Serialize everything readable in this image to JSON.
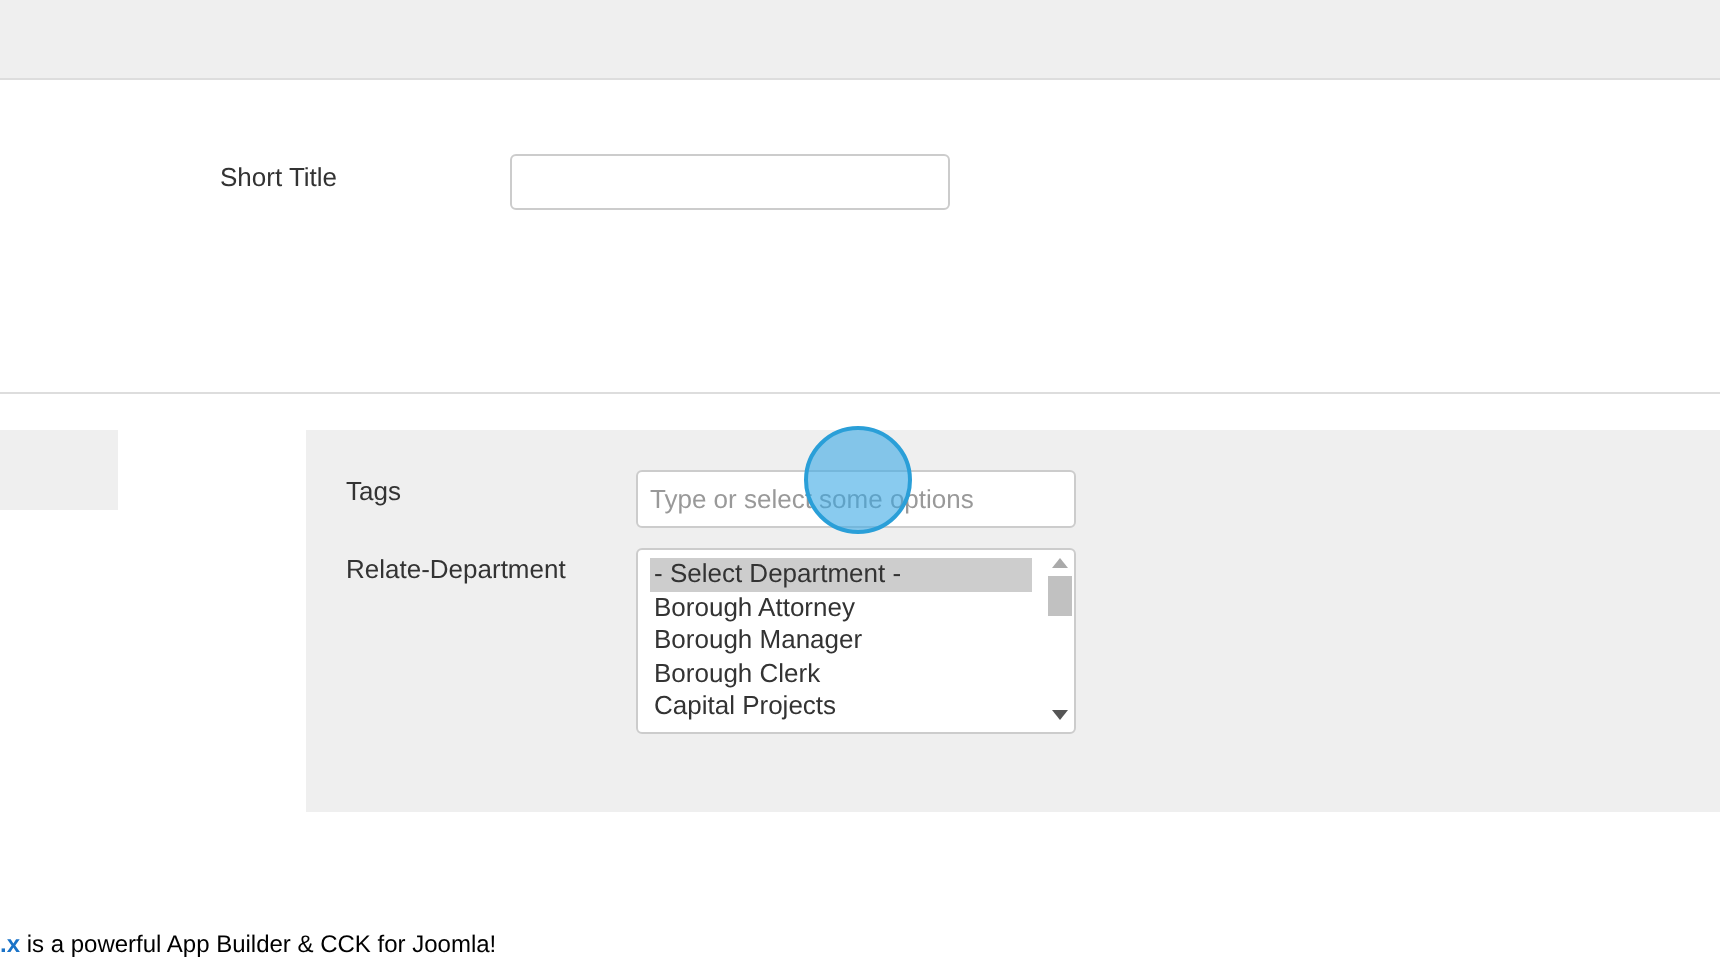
{
  "short_title": {
    "label": "Short Title"
  },
  "tags": {
    "label": "Tags",
    "placeholder": "Type or select some options"
  },
  "department": {
    "label": "Relate-Department",
    "options": [
      {
        "label": "- Select Department -",
        "selected": true
      },
      {
        "label": "Borough Attorney",
        "selected": false
      },
      {
        "label": "Borough Manager",
        "selected": false
      },
      {
        "label": "Borough Clerk",
        "selected": false
      },
      {
        "label": "Capital Projects",
        "selected": false
      }
    ]
  },
  "footer": {
    "link": ".x",
    "text": " is a powerful App Builder & CCK for Joomla!"
  }
}
